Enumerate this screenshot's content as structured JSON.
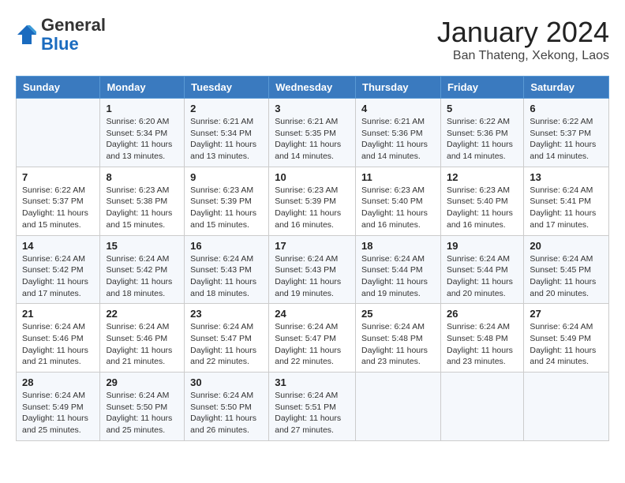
{
  "header": {
    "logo_general": "General",
    "logo_blue": "Blue",
    "month_title": "January 2024",
    "location": "Ban Thateng, Xekong, Laos"
  },
  "weekdays": [
    "Sunday",
    "Monday",
    "Tuesday",
    "Wednesday",
    "Thursday",
    "Friday",
    "Saturday"
  ],
  "weeks": [
    [
      {
        "day": "",
        "text": ""
      },
      {
        "day": "1",
        "text": "Sunrise: 6:20 AM\nSunset: 5:34 PM\nDaylight: 11 hours\nand 13 minutes."
      },
      {
        "day": "2",
        "text": "Sunrise: 6:21 AM\nSunset: 5:34 PM\nDaylight: 11 hours\nand 13 minutes."
      },
      {
        "day": "3",
        "text": "Sunrise: 6:21 AM\nSunset: 5:35 PM\nDaylight: 11 hours\nand 14 minutes."
      },
      {
        "day": "4",
        "text": "Sunrise: 6:21 AM\nSunset: 5:36 PM\nDaylight: 11 hours\nand 14 minutes."
      },
      {
        "day": "5",
        "text": "Sunrise: 6:22 AM\nSunset: 5:36 PM\nDaylight: 11 hours\nand 14 minutes."
      },
      {
        "day": "6",
        "text": "Sunrise: 6:22 AM\nSunset: 5:37 PM\nDaylight: 11 hours\nand 14 minutes."
      }
    ],
    [
      {
        "day": "7",
        "text": "Sunrise: 6:22 AM\nSunset: 5:37 PM\nDaylight: 11 hours\nand 15 minutes."
      },
      {
        "day": "8",
        "text": "Sunrise: 6:23 AM\nSunset: 5:38 PM\nDaylight: 11 hours\nand 15 minutes."
      },
      {
        "day": "9",
        "text": "Sunrise: 6:23 AM\nSunset: 5:39 PM\nDaylight: 11 hours\nand 15 minutes."
      },
      {
        "day": "10",
        "text": "Sunrise: 6:23 AM\nSunset: 5:39 PM\nDaylight: 11 hours\nand 16 minutes."
      },
      {
        "day": "11",
        "text": "Sunrise: 6:23 AM\nSunset: 5:40 PM\nDaylight: 11 hours\nand 16 minutes."
      },
      {
        "day": "12",
        "text": "Sunrise: 6:23 AM\nSunset: 5:40 PM\nDaylight: 11 hours\nand 16 minutes."
      },
      {
        "day": "13",
        "text": "Sunrise: 6:24 AM\nSunset: 5:41 PM\nDaylight: 11 hours\nand 17 minutes."
      }
    ],
    [
      {
        "day": "14",
        "text": "Sunrise: 6:24 AM\nSunset: 5:42 PM\nDaylight: 11 hours\nand 17 minutes."
      },
      {
        "day": "15",
        "text": "Sunrise: 6:24 AM\nSunset: 5:42 PM\nDaylight: 11 hours\nand 18 minutes."
      },
      {
        "day": "16",
        "text": "Sunrise: 6:24 AM\nSunset: 5:43 PM\nDaylight: 11 hours\nand 18 minutes."
      },
      {
        "day": "17",
        "text": "Sunrise: 6:24 AM\nSunset: 5:43 PM\nDaylight: 11 hours\nand 19 minutes."
      },
      {
        "day": "18",
        "text": "Sunrise: 6:24 AM\nSunset: 5:44 PM\nDaylight: 11 hours\nand 19 minutes."
      },
      {
        "day": "19",
        "text": "Sunrise: 6:24 AM\nSunset: 5:44 PM\nDaylight: 11 hours\nand 20 minutes."
      },
      {
        "day": "20",
        "text": "Sunrise: 6:24 AM\nSunset: 5:45 PM\nDaylight: 11 hours\nand 20 minutes."
      }
    ],
    [
      {
        "day": "21",
        "text": "Sunrise: 6:24 AM\nSunset: 5:46 PM\nDaylight: 11 hours\nand 21 minutes."
      },
      {
        "day": "22",
        "text": "Sunrise: 6:24 AM\nSunset: 5:46 PM\nDaylight: 11 hours\nand 21 minutes."
      },
      {
        "day": "23",
        "text": "Sunrise: 6:24 AM\nSunset: 5:47 PM\nDaylight: 11 hours\nand 22 minutes."
      },
      {
        "day": "24",
        "text": "Sunrise: 6:24 AM\nSunset: 5:47 PM\nDaylight: 11 hours\nand 22 minutes."
      },
      {
        "day": "25",
        "text": "Sunrise: 6:24 AM\nSunset: 5:48 PM\nDaylight: 11 hours\nand 23 minutes."
      },
      {
        "day": "26",
        "text": "Sunrise: 6:24 AM\nSunset: 5:48 PM\nDaylight: 11 hours\nand 23 minutes."
      },
      {
        "day": "27",
        "text": "Sunrise: 6:24 AM\nSunset: 5:49 PM\nDaylight: 11 hours\nand 24 minutes."
      }
    ],
    [
      {
        "day": "28",
        "text": "Sunrise: 6:24 AM\nSunset: 5:49 PM\nDaylight: 11 hours\nand 25 minutes."
      },
      {
        "day": "29",
        "text": "Sunrise: 6:24 AM\nSunset: 5:50 PM\nDaylight: 11 hours\nand 25 minutes."
      },
      {
        "day": "30",
        "text": "Sunrise: 6:24 AM\nSunset: 5:50 PM\nDaylight: 11 hours\nand 26 minutes."
      },
      {
        "day": "31",
        "text": "Sunrise: 6:24 AM\nSunset: 5:51 PM\nDaylight: 11 hours\nand 27 minutes."
      },
      {
        "day": "",
        "text": ""
      },
      {
        "day": "",
        "text": ""
      },
      {
        "day": "",
        "text": ""
      }
    ]
  ]
}
